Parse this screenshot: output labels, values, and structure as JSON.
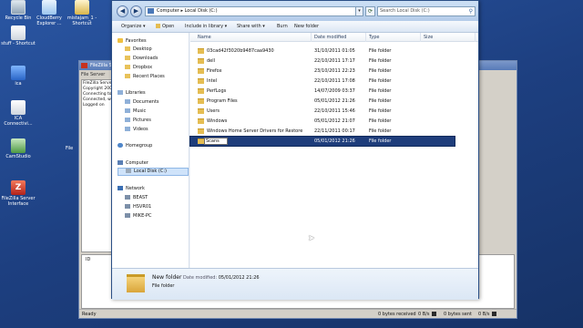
{
  "desktop": {
    "icons": [
      {
        "label": "Recycle Bin"
      },
      {
        "label": "CloudBerry Explorer ..."
      },
      {
        "label": "mistajam_1 - Shortcut"
      },
      {
        "label": "stuff - Shortcut"
      },
      {
        "label": "ica"
      },
      {
        "label": "ICA Connectivi..."
      },
      {
        "label": "CamStudio"
      },
      {
        "label": "FileZilla Server Interface"
      },
      {
        "label": "File"
      }
    ]
  },
  "filezilla": {
    "title": "FileZilla S",
    "menu": "File  Server",
    "log": [
      "FileZilla Server",
      "Copyright 200",
      "Connecting to",
      "Connected, w",
      "Logged on"
    ],
    "grid_header": "ID",
    "status_ready": "Ready",
    "bytes_received": "0 bytes received",
    "received_rate": "0 B/s",
    "bytes_sent": "0 bytes sent",
    "sent_rate": "0 B/s"
  },
  "explorer": {
    "address": {
      "computer": "Computer",
      "sep": "▸",
      "drive": "Local Disk (C:)"
    },
    "search_placeholder": "Search Local Disk (C:)",
    "toolbar": {
      "organize": "Organize ▾",
      "open": "Open",
      "include": "Include in library ▾",
      "share": "Share with ▾",
      "burn": "Burn",
      "new_folder": "New folder"
    },
    "nav": {
      "favorites": "Favorites",
      "desktop": "Desktop",
      "downloads": "Downloads",
      "dropbox": "Dropbox",
      "recent": "Recent Places",
      "libraries": "Libraries",
      "documents": "Documents",
      "music": "Music",
      "pictures": "Pictures",
      "videos": "Videos",
      "homegroup": "Homegroup",
      "computer": "Computer",
      "local_disk": "Local Disk (C:)",
      "network": "Network",
      "beast": "BEAST",
      "hsvr01": "HSVR01",
      "mike_pc": "MIKE-PC"
    },
    "columns": {
      "name": "Name",
      "date": "Date modified",
      "type": "Type",
      "size": "Size"
    },
    "rows": [
      {
        "name": "03cad42f3020b9487caa9430",
        "date": "31/10/2011 01:05",
        "type": "File folder"
      },
      {
        "name": "dell",
        "date": "22/10/2011 17:17",
        "type": "File folder"
      },
      {
        "name": "Firefox",
        "date": "23/10/2011 22:23",
        "type": "File folder"
      },
      {
        "name": "Intel",
        "date": "22/10/2011 17:08",
        "type": "File folder"
      },
      {
        "name": "PerfLogs",
        "date": "14/07/2009 03:37",
        "type": "File folder"
      },
      {
        "name": "Program Files",
        "date": "05/01/2012 21:26",
        "type": "File folder"
      },
      {
        "name": "Users",
        "date": "22/10/2011 15:46",
        "type": "File folder"
      },
      {
        "name": "Windows",
        "date": "05/01/2012 21:07",
        "type": "File folder"
      },
      {
        "name": "Windows Home Server Drivers for Restore",
        "date": "22/11/2011 00:17",
        "type": "File folder"
      },
      {
        "name": "Scans",
        "date": "05/01/2012 21:26",
        "type": "File folder"
      }
    ],
    "details": {
      "name": "New folder",
      "date_label": "Date modified:",
      "date_value": "05/01/2012 21:26",
      "type": "File folder"
    }
  }
}
